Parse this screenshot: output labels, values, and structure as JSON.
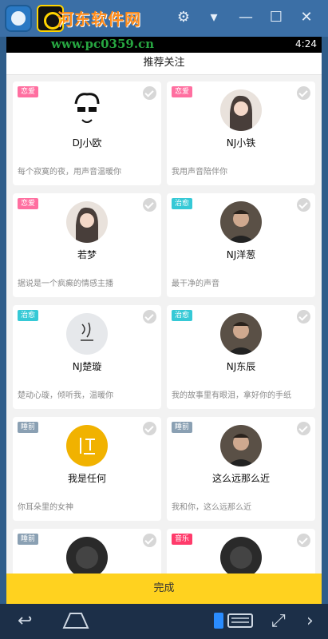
{
  "watermark": {
    "title": "河东软件网",
    "url": "www.pc0359.cn"
  },
  "status": {
    "time": "4:24"
  },
  "header": {
    "title": "推荐关注"
  },
  "colors": {
    "love": "#ff6fa0",
    "heal": "#36c9d6",
    "sleep": "#8aa0b3",
    "music": "#ff3b6b",
    "accent": "#ffd21f"
  },
  "cards": [
    {
      "tag": "恋爱",
      "tag_color": "#ff6fa0",
      "name": "DJ小欧",
      "desc": "每个寂寞的夜，用声音温暖你",
      "avatar": "sketch-face-avatar"
    },
    {
      "tag": "恋爱",
      "tag_color": "#ff6fa0",
      "name": "NJ小铁",
      "desc": "我用声音陪伴你",
      "avatar": "girl-avatar"
    },
    {
      "tag": "恋爱",
      "tag_color": "#ff6fa0",
      "name": "若梦",
      "desc": "据说是一个疯癫的情感主播",
      "avatar": "girl-avatar"
    },
    {
      "tag": "治愈",
      "tag_color": "#36c9d6",
      "name": "NJ洋葱",
      "desc": "最干净的声音",
      "avatar": "man-avatar"
    },
    {
      "tag": "治愈",
      "tag_color": "#36c9d6",
      "name": "NJ楚璇",
      "desc": "楚动心璇，倾听我，温暖你",
      "avatar": "calligraphy-avatar"
    },
    {
      "tag": "治愈",
      "tag_color": "#36c9d6",
      "name": "NJ东辰",
      "desc": "我的故事里有眼泪，拿好你的手纸",
      "avatar": "man-avatar"
    },
    {
      "tag": "睡前",
      "tag_color": "#8aa0b3",
      "name": "我是任何",
      "desc": "你耳朵里的女神",
      "avatar": "yellow-logo-avatar"
    },
    {
      "tag": "睡前",
      "tag_color": "#8aa0b3",
      "name": "这么远那么近",
      "desc": "我和你，这么远那么近",
      "avatar": "man-avatar"
    },
    {
      "tag": "睡前",
      "tag_color": "#8aa0b3",
      "name": "",
      "desc": "",
      "avatar": "dark-avatar"
    },
    {
      "tag": "音乐",
      "tag_color": "#ff3b6b",
      "name": "",
      "desc": "",
      "avatar": "dark-avatar"
    }
  ],
  "done": {
    "label": "完成"
  },
  "nav": {
    "back": "back-icon",
    "home": "home-icon",
    "keyboard": "keyboard-icon",
    "fullscreen": "fullscreen-icon"
  }
}
